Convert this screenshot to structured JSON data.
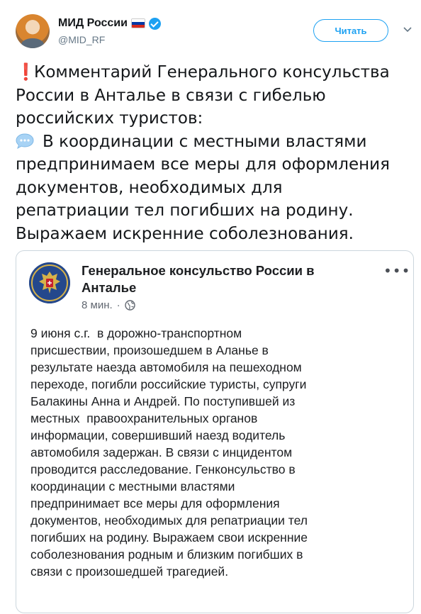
{
  "header": {
    "display_name": "МИД России",
    "flag": "russia-flag-icon",
    "verified": "verified-badge-icon",
    "handle": "@MID_RF",
    "follow_label": "Читать",
    "menu_icon": "chevron-down-icon"
  },
  "tweet": {
    "lines": [
      "Комментарий Генерального консульства",
      "России в Анталье в связи с гибелью",
      "российских туристов:",
      "В координации с местными властями",
      "предпринимаем все меры для оформления",
      "документов, необходимых для",
      "репатриации тел погибших на родину.",
      "Выражаем искренние соболезнования."
    ],
    "emoji_1": "❗",
    "emoji_2": "speech-bubble-icon"
  },
  "card": {
    "logo": "consulate-emblem-icon",
    "title_line_1": "Генеральное консульство России в",
    "title_line_2": "Анталье",
    "time": "8 мин.",
    "separator": "·",
    "audience_icon": "globe-icon",
    "menu": "•••",
    "body_lines": [
      "9 июня с.г.  в дорожно-транспортном",
      "присшествии, произошедшем в Аланье в",
      "результате наезда автомобиля на пешеходном",
      "переходе, погибли российские туристы, супруги",
      "Балакины Анна и Андрей. По поступившей из",
      "местных  правоохранительных органов",
      "информации, совершивший наезд водитель",
      "автомобиля задержан. В связи с инцидентом",
      "проводится расследование. Генконсульство в",
      "координации с местными властями",
      "предпринимает все меры для оформления",
      "документов, необходимых для репатриации тел",
      "погибших на родину. Выражаем свои искренние",
      "соболезнования родным и близким погибших в",
      "связи с произошедшей трагедией."
    ]
  },
  "colors": {
    "accent": "#1da1f2",
    "text": "#14171a",
    "muted": "#657786",
    "border": "#ccd6dd"
  }
}
